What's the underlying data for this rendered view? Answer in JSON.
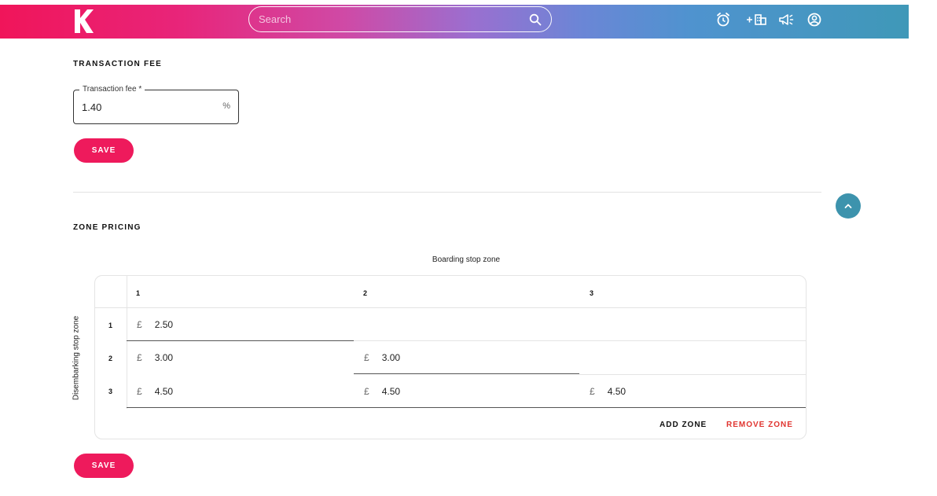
{
  "header": {
    "search_placeholder": "Search",
    "icons": [
      "alarm-icon",
      "add-building-icon",
      "megaphone-icon",
      "account-icon"
    ],
    "gradient_start": "#f0155a",
    "gradient_end": "#3f98b8"
  },
  "transaction_fee": {
    "section_title": "TRANSACTION FEE",
    "field_label": "Transaction fee *",
    "value": "1.40",
    "unit": "%",
    "save_label": "SAVE"
  },
  "zone_pricing": {
    "section_title": "ZONE PRICING",
    "boarding_axis_label": "Boarding stop zone",
    "disembarking_axis_label": "Disembarking stop zone",
    "columns": [
      "1",
      "2",
      "3"
    ],
    "rows": [
      {
        "label": "1",
        "cells": [
          {
            "currency": "£",
            "value": "2.50"
          }
        ]
      },
      {
        "label": "2",
        "cells": [
          {
            "currency": "£",
            "value": "3.00"
          },
          {
            "currency": "£",
            "value": "3.00"
          }
        ]
      },
      {
        "label": "3",
        "cells": [
          {
            "currency": "£",
            "value": "4.50"
          },
          {
            "currency": "£",
            "value": "4.50"
          },
          {
            "currency": "£",
            "value": "4.50"
          }
        ]
      }
    ],
    "add_zone_label": "ADD ZONE",
    "remove_zone_label": "REMOVE ZONE",
    "save_label": "SAVE"
  },
  "colors": {
    "primary": "#ee1a5c",
    "danger": "#e0342f",
    "scroll_button": "#3d93ad"
  }
}
